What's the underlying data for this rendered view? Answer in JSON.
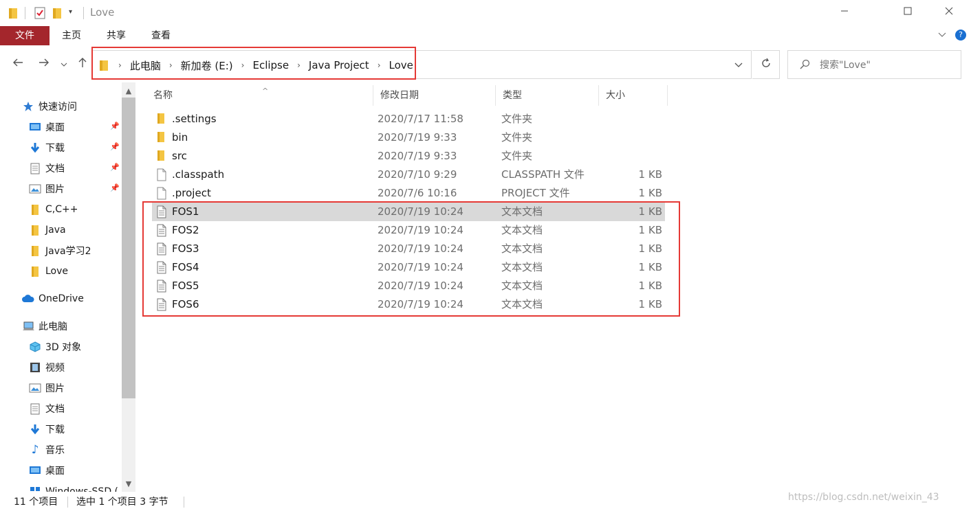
{
  "window": {
    "title": "Love",
    "minimize_icon": "minimize-icon",
    "maximize_icon": "maximize-icon",
    "close_icon": "close-icon"
  },
  "ribbon": {
    "tabs": [
      "文件",
      "主页",
      "共享",
      "查看"
    ]
  },
  "address": {
    "crumbs": [
      "此电脑",
      "新加卷 (E:)",
      "Eclipse",
      "Java Project",
      "Love"
    ]
  },
  "search": {
    "placeholder": "搜索\"Love\""
  },
  "nav": {
    "quick_access": "快速访问",
    "quick_items": [
      "桌面",
      "下载",
      "文档",
      "图片"
    ],
    "folders": [
      "C,C++",
      "Java",
      "Java学习2",
      "Love"
    ],
    "onedrive": "OneDrive",
    "this_pc": "此电脑",
    "pc_items": [
      "3D 对象",
      "视频",
      "图片",
      "文档",
      "下载",
      "音乐",
      "桌面"
    ],
    "partial_item": "Windows-SSD ("
  },
  "columns": {
    "name": "名称",
    "date": "修改日期",
    "type": "类型",
    "size": "大小"
  },
  "files": [
    {
      "name": ".settings",
      "date": "2020/7/17 11:58",
      "type": "文件夹",
      "size": "",
      "icon": "folder"
    },
    {
      "name": "bin",
      "date": "2020/7/19 9:33",
      "type": "文件夹",
      "size": "",
      "icon": "folder"
    },
    {
      "name": "src",
      "date": "2020/7/19 9:33",
      "type": "文件夹",
      "size": "",
      "icon": "folder"
    },
    {
      "name": ".classpath",
      "date": "2020/7/10 9:29",
      "type": "CLASSPATH 文件",
      "size": "1 KB",
      "icon": "file"
    },
    {
      "name": ".project",
      "date": "2020/7/6 10:16",
      "type": "PROJECT 文件",
      "size": "1 KB",
      "icon": "file"
    },
    {
      "name": "FOS1",
      "date": "2020/7/19 10:24",
      "type": "文本文档",
      "size": "1 KB",
      "icon": "text"
    },
    {
      "name": "FOS2",
      "date": "2020/7/19 10:24",
      "type": "文本文档",
      "size": "1 KB",
      "icon": "text"
    },
    {
      "name": "FOS3",
      "date": "2020/7/19 10:24",
      "type": "文本文档",
      "size": "1 KB",
      "icon": "text"
    },
    {
      "name": "FOS4",
      "date": "2020/7/19 10:24",
      "type": "文本文档",
      "size": "1 KB",
      "icon": "text"
    },
    {
      "name": "FOS5",
      "date": "2020/7/19 10:24",
      "type": "文本文档",
      "size": "1 KB",
      "icon": "text"
    },
    {
      "name": "FOS6",
      "date": "2020/7/19 10:24",
      "type": "文本文档",
      "size": "1 KB",
      "icon": "text"
    }
  ],
  "status": {
    "count": "11 个项目",
    "selection": "选中 1 个项目  3 字节"
  },
  "watermark": "https://blog.csdn.net/weixin_43",
  "colors": {
    "file_tab": "#a4262c",
    "highlight_box": "#e53935",
    "selected_row": "#d9d9d9",
    "folder": "#f4c542"
  }
}
